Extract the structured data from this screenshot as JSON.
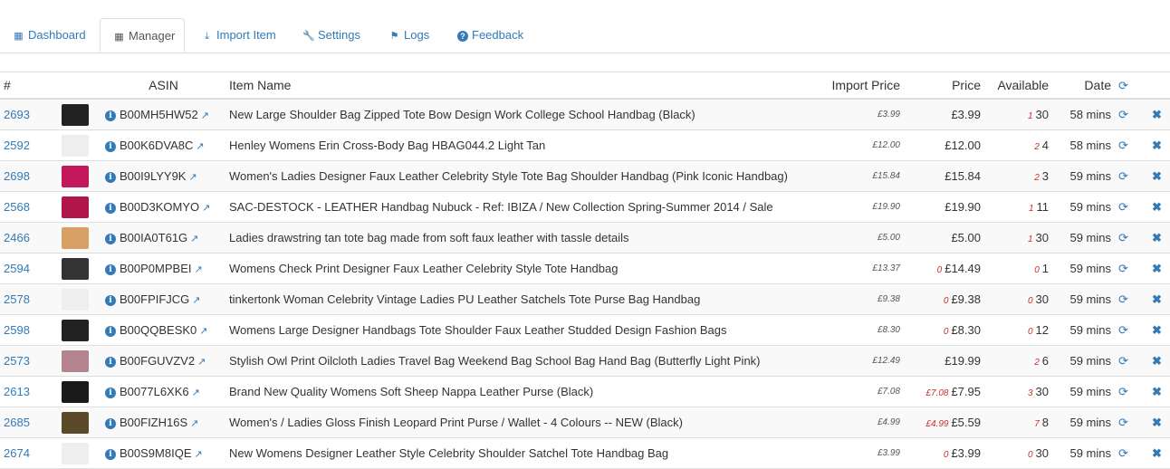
{
  "tabs": [
    {
      "label": "Dashboard",
      "icon": "grid-icon",
      "glyph": "▦"
    },
    {
      "label": "Manager",
      "icon": "calendar-icon",
      "glyph": "▦"
    },
    {
      "label": "Import Item",
      "icon": "import-icon",
      "glyph": "⤓"
    },
    {
      "label": "Settings",
      "icon": "wrench-icon",
      "glyph": "🔧"
    },
    {
      "label": "Logs",
      "icon": "flag-icon",
      "glyph": "⚑"
    },
    {
      "label": "Feedback",
      "icon": "question-circle-icon",
      "glyph": "?"
    }
  ],
  "table": {
    "headers": {
      "num": "#",
      "asin": "ASIN",
      "name": "Item Name",
      "import_price": "Import Price",
      "price": "Price",
      "available": "Available",
      "date": "Date"
    },
    "rows": [
      {
        "id": "2693",
        "asin": "B00MH5HW52",
        "name": "New Large Shoulder Bag Zipped Tote Bow Design Work College School Handbag (Black)",
        "import_price": "£3.99",
        "price_prefix": "",
        "price": "£3.99",
        "avail_prefix": "1",
        "available": "30",
        "date": "58 mins",
        "thumb_color": "#222"
      },
      {
        "id": "2592",
        "asin": "B00K6DVA8C",
        "name": "Henley Womens Erin Cross-Body Bag HBAG044.2 Light Tan",
        "import_price": "£12.00",
        "price_prefix": "",
        "price": "£12.00",
        "avail_prefix": "2",
        "available": "4",
        "date": "58 mins",
        "thumb_color": "#eee"
      },
      {
        "id": "2698",
        "asin": "B00I9LYY9K",
        "name": "Women's Ladies Designer Faux Leather Celebrity Style Tote Bag Shoulder Handbag (Pink Iconic Handbag)",
        "import_price": "£15.84",
        "price_prefix": "",
        "price": "£15.84",
        "avail_prefix": "2",
        "available": "3",
        "date": "59 mins",
        "thumb_color": "#c2185b"
      },
      {
        "id": "2568",
        "asin": "B00D3KOMYO",
        "name": "SAC-DESTOCK - LEATHER Handbag Nubuck - Ref: IBIZA / New Collection Spring-Summer 2014 / Sale",
        "import_price": "£19.90",
        "price_prefix": "",
        "price": "£19.90",
        "avail_prefix": "1",
        "available": "11",
        "date": "59 mins",
        "thumb_color": "#b0164a"
      },
      {
        "id": "2466",
        "asin": "B00IA0T61G",
        "name": "Ladies drawstring tan tote bag made from soft faux leather with tassle details",
        "import_price": "£5.00",
        "price_prefix": "",
        "price": "£5.00",
        "avail_prefix": "1",
        "available": "30",
        "date": "59 mins",
        "thumb_color": "#d9a066"
      },
      {
        "id": "2594",
        "asin": "B00P0MPBEI",
        "name": "Womens Check Print Designer Faux Leather Celebrity Style Tote Handbag",
        "import_price": "£13.37",
        "price_prefix": "0",
        "price": "£14.49",
        "avail_prefix": "0",
        "available": "1",
        "date": "59 mins",
        "thumb_color": "#333"
      },
      {
        "id": "2578",
        "asin": "B00FPIFJCG",
        "name": "tinkertonk Woman Celebrity Vintage Ladies PU Leather Satchels Tote Purse Bag Handbag",
        "import_price": "£9.38",
        "price_prefix": "0",
        "price": "£9.38",
        "avail_prefix": "0",
        "available": "30",
        "date": "59 mins",
        "thumb_color": "#eee"
      },
      {
        "id": "2598",
        "asin": "B00QQBESK0",
        "name": "Womens Large Designer Handbags Tote Shoulder Faux Leather Studded Design Fashion Bags",
        "import_price": "£8.30",
        "price_prefix": "0",
        "price": "£8.30",
        "avail_prefix": "0",
        "available": "12",
        "date": "59 mins",
        "thumb_color": "#222"
      },
      {
        "id": "2573",
        "asin": "B00FGUVZV2",
        "name": "Stylish Owl Print Oilcloth Ladies Travel Bag Weekend Bag School Bag Hand Bag (Butterfly Light Pink)",
        "import_price": "£12.49",
        "price_prefix": "",
        "price": "£19.99",
        "avail_prefix": "2",
        "available": "6",
        "date": "59 mins",
        "thumb_color": "#b5838d"
      },
      {
        "id": "2613",
        "asin": "B0077L6XK6",
        "name": "Brand New Quality Womens Soft Sheep Nappa Leather Purse (Black)",
        "import_price": "£7.08",
        "price_prefix": "£7.08",
        "price": "£7.95",
        "avail_prefix": "3",
        "available": "30",
        "date": "59 mins",
        "thumb_color": "#1a1a1a"
      },
      {
        "id": "2685",
        "asin": "B00FIZH16S",
        "name": "Women's / Ladies Gloss Finish Leopard Print Purse / Wallet - 4 Colours -- NEW (Black)",
        "import_price": "£4.99",
        "price_prefix": "£4.99",
        "price": "£5.59",
        "avail_prefix": "7",
        "available": "8",
        "date": "59 mins",
        "thumb_color": "#5a4a2a"
      },
      {
        "id": "2674",
        "asin": "B00S9M8IQE",
        "name": "New Womens Designer Leather Style Celebrity Shoulder Satchel Tote Handbag Bag",
        "import_price": "£3.99",
        "price_prefix": "0",
        "price": "£3.99",
        "avail_prefix": "0",
        "available": "30",
        "date": "59 mins",
        "thumb_color": "#eee"
      }
    ]
  },
  "colors": {
    "link": "#337ab7",
    "danger": "#c9302c",
    "stripe": "#f9f9f9",
    "border": "#ddd"
  }
}
